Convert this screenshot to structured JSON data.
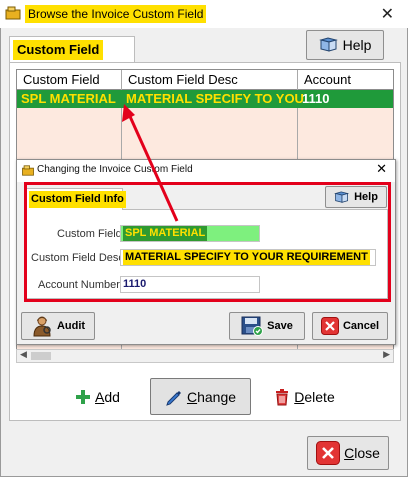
{
  "window": {
    "title": "Browse the Invoice Custom Field",
    "close_glyph": "✕"
  },
  "main_tab": {
    "label": "Custom Field"
  },
  "toolbar": {
    "help_label": "Help"
  },
  "grid": {
    "columns": [
      "Custom Field",
      "Custom Field Desc",
      "Account"
    ],
    "rows": [
      {
        "custom_field": "SPL MATERIAL",
        "custom_field_desc": "MATERIAL SPECIFY TO  YOU",
        "account": "1110"
      }
    ]
  },
  "dialog": {
    "title": "Changing the Invoice Custom Field",
    "close_glyph": "✕",
    "tab_label": "Custom Field Info",
    "help_label": "Help",
    "fields": {
      "custom_field_label": "Custom Field:",
      "custom_field_value": "SPL MATERIAL",
      "desc_label": "Custom Field Desc:",
      "desc_value": "MATERIAL SPECIFY TO  YOUR REQUIREMENT",
      "account_label": "Account Number:",
      "account_value": "1110"
    },
    "buttons": {
      "audit": "Audit",
      "save": "Save",
      "cancel": "Cancel"
    }
  },
  "actions": {
    "add_u": "A",
    "add_rest": "dd",
    "change_u": "C",
    "change_rest": "hange",
    "delete_u": "D",
    "delete_rest": "elete",
    "close_u": "C",
    "close_rest": "lose"
  },
  "colors": {
    "highlight": "#ffe000",
    "row_green": "#1f9a3a",
    "annotation_red": "#e3001b",
    "grid_bg": "#fde9df"
  },
  "icons": [
    "window-app-icon",
    "help-book-icon",
    "audit-person-icon",
    "save-disk-icon",
    "cancel-x-icon",
    "add-plus-icon",
    "change-pencil-icon",
    "delete-trash-icon",
    "close-x-icon"
  ]
}
